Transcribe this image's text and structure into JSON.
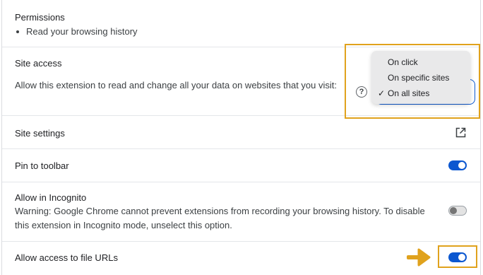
{
  "permissions": {
    "title": "Permissions",
    "items": [
      "Read your browsing history"
    ]
  },
  "site_access": {
    "title": "Site access",
    "description": "Allow this extension to read and change all your data on websites that you visit:",
    "help_icon": "help-circle-icon",
    "menu": {
      "options": [
        "On click",
        "On specific sites",
        "On all sites"
      ],
      "selected": "On all sites",
      "check_mark": "✓"
    }
  },
  "site_settings": {
    "label": "Site settings",
    "icon": "open-in-new-icon"
  },
  "pin_to_toolbar": {
    "label": "Pin to toolbar",
    "enabled": true
  },
  "incognito": {
    "label": "Allow in Incognito",
    "warning": "Warning: Google Chrome cannot prevent extensions from recording your browsing history. To disable this extension in Incognito mode, unselect this option.",
    "enabled": false
  },
  "file_urls": {
    "label": "Allow access to file URLs",
    "enabled": true
  },
  "colors": {
    "accent": "#0b57d0",
    "highlight": "#e0a21d"
  }
}
